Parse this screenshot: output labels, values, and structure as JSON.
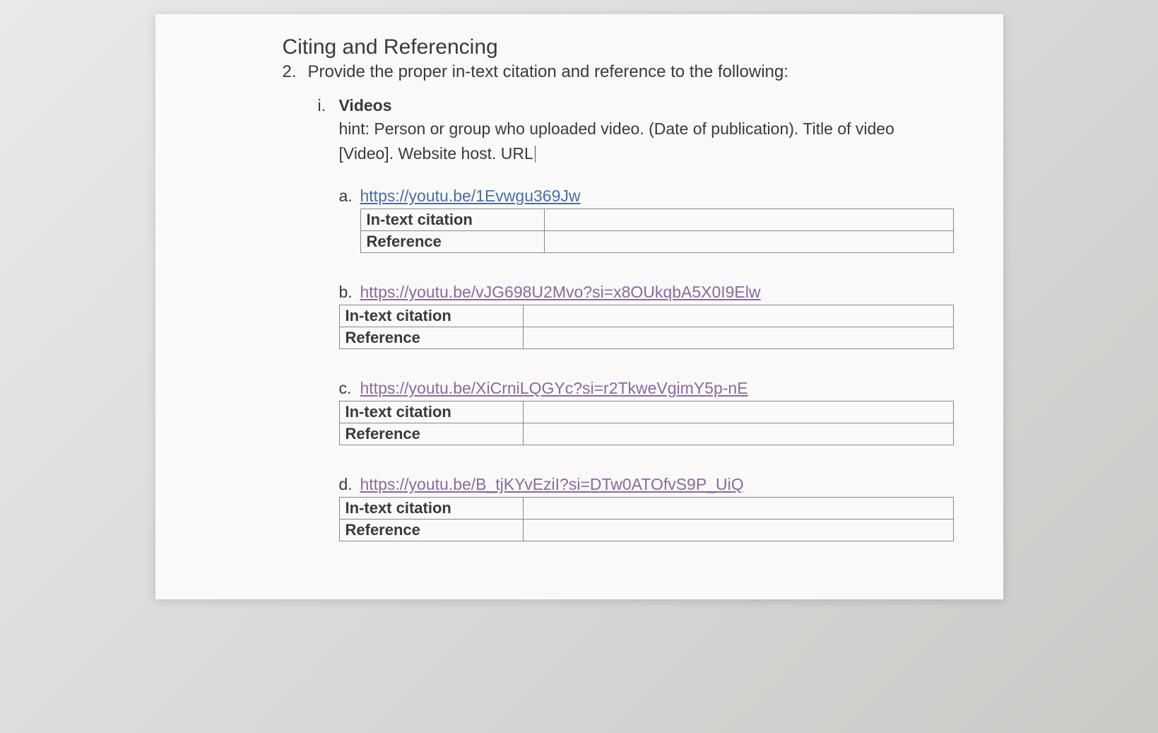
{
  "title": "Citing and Referencing",
  "question": {
    "number": "2.",
    "text": "Provide the proper in-text citation and reference to the following:"
  },
  "section": {
    "marker": "i.",
    "title": "Videos",
    "hint": "hint: Person or group who uploaded video. (Date of publication). Title of video [Video]. Website host. URL"
  },
  "labels": {
    "intext": "In-text citation",
    "reference": "Reference"
  },
  "items": [
    {
      "marker": "a.",
      "link": "https://youtu.be/1Evwgu369Jw",
      "visited": false,
      "intext_value": "",
      "reference_value": "",
      "indented_table": true
    },
    {
      "marker": "b.",
      "link": "https://youtu.be/vJG698U2Mvo?si=x8OUkqbA5X0I9Elw",
      "visited": true,
      "intext_value": "",
      "reference_value": "",
      "indented_table": false
    },
    {
      "marker": "c.",
      "link": "https://youtu.be/XiCrniLQGYc?si=r2TkweVgimY5p-nE",
      "visited": true,
      "intext_value": "",
      "reference_value": "",
      "indented_table": false
    },
    {
      "marker": "d.",
      "link": "https://youtu.be/B_tjKYvEziI?si=DTw0ATOfvS9P_UiQ",
      "visited": true,
      "intext_value": "",
      "reference_value": "",
      "indented_table": false
    }
  ]
}
